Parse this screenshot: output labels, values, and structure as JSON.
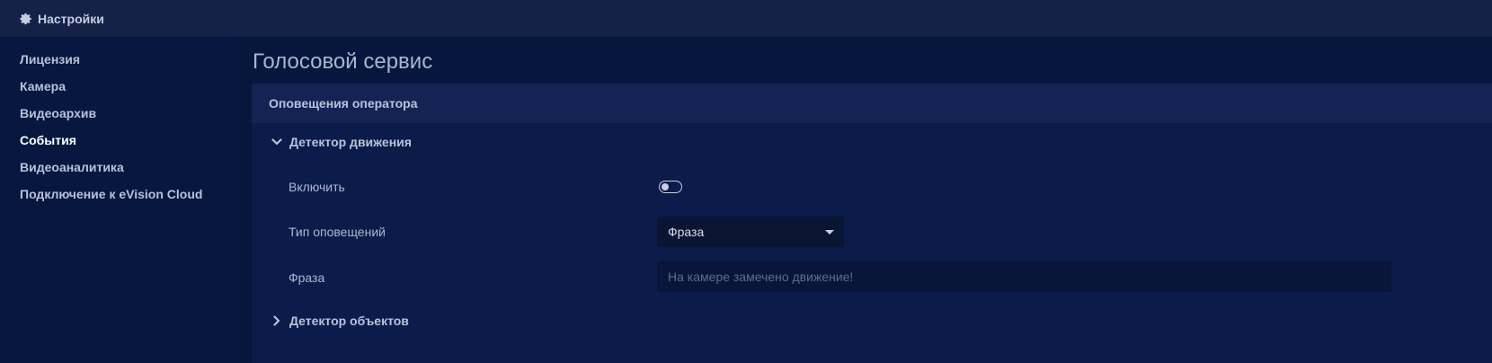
{
  "header": {
    "title": "Настройки",
    "icon": "gear-icon"
  },
  "sidebar": {
    "items": [
      {
        "label": "Лицензия",
        "active": false
      },
      {
        "label": "Камера",
        "active": false
      },
      {
        "label": "Видеоархив",
        "active": false
      },
      {
        "label": "События",
        "active": true
      },
      {
        "label": "Видеоаналитика",
        "active": false
      },
      {
        "label": "Подключение к eVision Cloud",
        "active": false
      }
    ]
  },
  "main": {
    "page_title": "Голосовой сервис",
    "card": {
      "title": "Оповещения оператора",
      "sections": [
        {
          "title": "Детектор движения",
          "expanded": true
        },
        {
          "title": "Детектор объектов",
          "expanded": false
        }
      ],
      "fields": {
        "enable_label": "Включить",
        "enable_value": false,
        "type_label": "Тип оповещений",
        "type_value": "Фраза",
        "phrase_label": "Фраза",
        "phrase_value": "",
        "phrase_placeholder": "На камере замечено движение!"
      }
    }
  },
  "colors": {
    "background": "#06153a",
    "topbar": "#152248",
    "card": "#0b1b4a",
    "card_header": "#142354"
  }
}
